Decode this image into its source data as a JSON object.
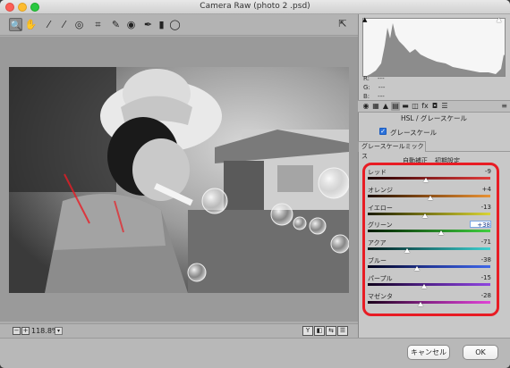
{
  "window": {
    "title": "Camera Raw (photo 2 .psd)"
  },
  "toolbar": {
    "tools": [
      {
        "name": "zoom-tool-icon",
        "glyph": "🔍",
        "active": true
      },
      {
        "name": "hand-tool-icon",
        "glyph": "✋"
      },
      {
        "name": "white-balance-tool-icon",
        "glyph": "⁄"
      },
      {
        "name": "color-sampler-tool-icon",
        "glyph": "⁄"
      },
      {
        "name": "targeted-adjustment-tool-icon",
        "glyph": "◎"
      },
      {
        "name": "crop-tool-icon",
        "glyph": "⌗"
      },
      {
        "name": "spot-removal-tool-icon",
        "glyph": "✎"
      },
      {
        "name": "red-eye-tool-icon",
        "glyph": "◉"
      },
      {
        "name": "adjustment-brush-icon",
        "glyph": "✒"
      },
      {
        "name": "graduated-filter-icon",
        "glyph": "▮"
      },
      {
        "name": "radial-filter-icon",
        "glyph": "◯"
      }
    ],
    "open_prefs_icon": "⇱"
  },
  "histogram": {
    "r_label": "R:",
    "g_label": "G:",
    "b_label": "B:",
    "r_value": "---",
    "g_value": "---",
    "b_value": "---",
    "clip_shadow_icon": "▲",
    "clip_highlight_icon": "▲"
  },
  "panel_tabs": {
    "icons": [
      "◉",
      "▦",
      "▲",
      "▤",
      "▬",
      "◫",
      "fx",
      "◘",
      "☰"
    ],
    "active_index": 3,
    "menu_icon": "≡"
  },
  "hsl": {
    "section_title": "HSL / グレースケール",
    "grayscale_label": "グレースケール",
    "grayscale_checked": true,
    "mix_tab": "グレースケールミックス",
    "auto_link": "自動補正",
    "default_link": "初期設定",
    "sliders": [
      {
        "label": "レッド",
        "value": "-9",
        "num": -9,
        "colors": [
          "#1a0000",
          "#8b1f1f",
          "#e23b3b"
        ]
      },
      {
        "label": "オレンジ",
        "value": "+4",
        "num": 4,
        "colors": [
          "#1e0e00",
          "#8f5118",
          "#e89235"
        ]
      },
      {
        "label": "イエロー",
        "value": "-13",
        "num": -13,
        "colors": [
          "#1a1a00",
          "#7d7a18",
          "#d9d435"
        ]
      },
      {
        "label": "グリーン",
        "value": "+38",
        "num": 38,
        "colors": [
          "#001a00",
          "#217a21",
          "#3fcf3f"
        ],
        "selected": true
      },
      {
        "label": "アクア",
        "value": "-71",
        "num": -71,
        "colors": [
          "#001a1a",
          "#1e7a7a",
          "#3fd0d0"
        ]
      },
      {
        "label": "ブルー",
        "value": "-38",
        "num": -38,
        "colors": [
          "#00001a",
          "#23389a",
          "#3e66e8"
        ]
      },
      {
        "label": "パープル",
        "value": "-15",
        "num": -15,
        "colors": [
          "#0e001a",
          "#54228f",
          "#8f45e0"
        ]
      },
      {
        "label": "マゼンタ",
        "value": "-28",
        "num": -28,
        "colors": [
          "#1a001a",
          "#8a238a",
          "#e044d6"
        ]
      }
    ]
  },
  "bottom_bar": {
    "zoom_out": "−",
    "zoom_in": "+",
    "zoom_level": "118.8%",
    "zoom_dropdown": "▾",
    "view_buttons": [
      "Y",
      "◧",
      "⇆",
      "☰"
    ]
  },
  "footer": {
    "cancel_label": "キャンセル",
    "ok_label": "OK"
  }
}
